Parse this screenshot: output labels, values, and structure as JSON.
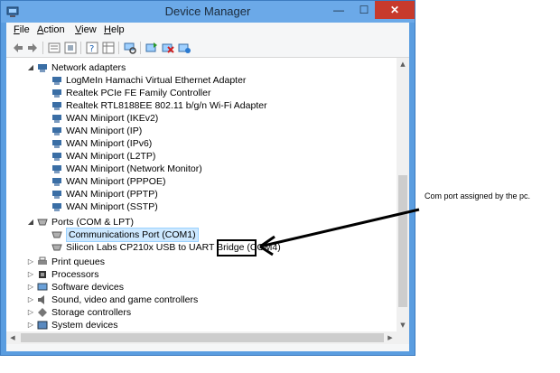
{
  "window": {
    "title": "Device Manager",
    "minimize_glyph": "—",
    "maximize_glyph": "☐",
    "close_glyph": "✕"
  },
  "menu": {
    "file": {
      "accel": "F",
      "rest": "ile"
    },
    "action": {
      "accel": "A",
      "rest": "ction"
    },
    "view": {
      "accel": "V",
      "rest": "iew"
    },
    "help": {
      "accel": "H",
      "rest": "elp"
    }
  },
  "toolbar": {
    "icons": [
      "back-arrow-icon",
      "forward-arrow-icon",
      "properties-icon",
      "help-page-icon",
      "help-book-icon",
      "monitor-scan-icon",
      "update-driver-icon",
      "uninstall-icon",
      "enable-device-icon"
    ]
  },
  "tree": {
    "network_adapters": {
      "label": "Network adapters",
      "items": [
        "LogMeIn Hamachi Virtual Ethernet Adapter",
        "Realtek PCIe FE Family Controller",
        "Realtek RTL8188EE 802.11 b/g/n Wi-Fi Adapter",
        "WAN Miniport (IKEv2)",
        "WAN Miniport (IP)",
        "WAN Miniport (IPv6)",
        "WAN Miniport (L2TP)",
        "WAN Miniport (Network Monitor)",
        "WAN Miniport (PPPOE)",
        "WAN Miniport (PPTP)",
        "WAN Miniport (SSTP)"
      ]
    },
    "ports": {
      "label": "Ports (COM & LPT)",
      "items": [
        "Communications Port (COM1)",
        "Silicon Labs CP210x USB to UART Bridge (COM4)"
      ]
    },
    "collapsed": [
      "Print queues",
      "Processors",
      "Software devices",
      "Sound, video and game controllers",
      "Storage controllers",
      "System devices"
    ]
  },
  "annotation": {
    "text": "Com port assigned by the pc."
  },
  "colors": {
    "title_bar": "#6ba9e8",
    "close_button": "#c73a2c",
    "selection": "#cde8ff"
  }
}
